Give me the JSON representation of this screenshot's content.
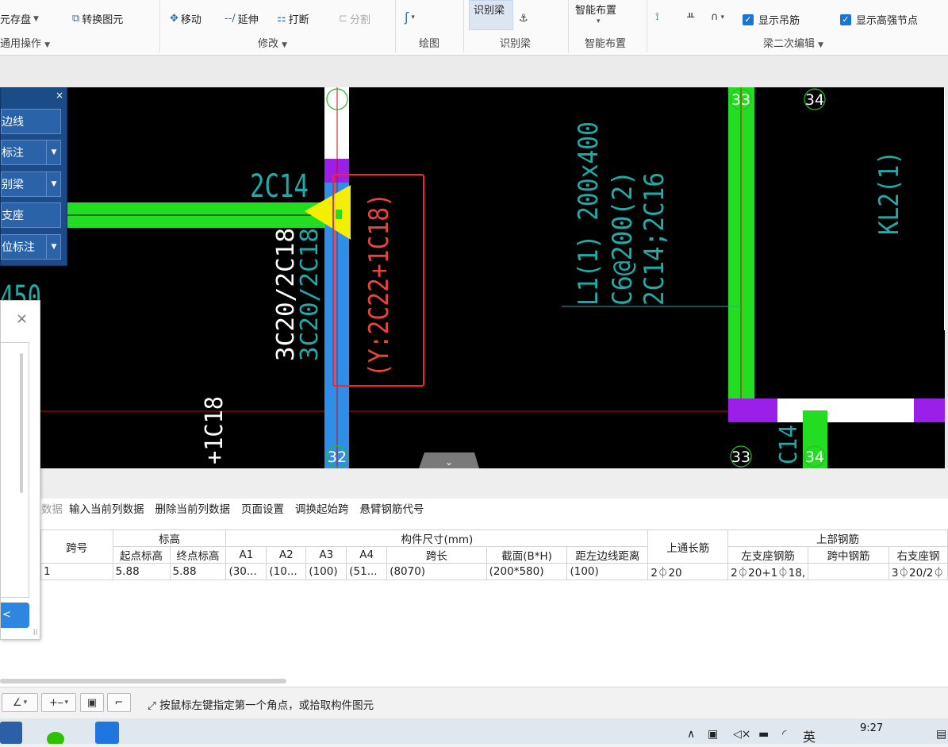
{
  "ribbon": {
    "group_common": "通用操作",
    "save_layout": "元存盘",
    "convert_entity": "转换图元",
    "move": "移动",
    "extend": "延伸",
    "break": "打断",
    "split": "分割",
    "group_modify": "修改",
    "group_draw": "绘图",
    "identify_beam_btn": "识别梁",
    "group_identify": "识别梁",
    "smart_layout_btn": "智能布置",
    "group_smart": "智能布置",
    "show_hanger": "显示吊筋",
    "show_hs_node": "显示高强节点",
    "group_beam_edit": "梁二次编辑"
  },
  "float_panel": {
    "items": [
      "边线",
      "标注",
      "别梁",
      "支座",
      "位标注"
    ],
    "close": "×"
  },
  "dialog": {
    "close": "×",
    "confirm_btn": "<"
  },
  "canvas": {
    "texts": {
      "t_2c14": "2C14",
      "t_3c20_white": "3C20/2C18",
      "t_3c20_cyan": "3C20/2C18",
      "t_y_red": "(Y:2C22+1C18)",
      "t_l1": "L1(1) 200x400",
      "t_c6": "C6@200(2)",
      "t_2c14b": "2C14;2C16",
      "t_kl2": "KL2(1)",
      "t_450": "450",
      "t_1c18": "+1C18",
      "t_c14": "C14",
      "n32": "32",
      "n33a": "33",
      "n34a": "34",
      "n33b": "33",
      "n34b": "34",
      "collapse": "⌄"
    }
  },
  "table_toolbar": [
    "数据",
    "输入当前列数据",
    "删除当前列数据",
    "页面设置",
    "调换起始跨",
    "悬臂钢筋代号"
  ],
  "table": {
    "header_top": {
      "span_no": "跨号",
      "elevation": "标高",
      "size": "构件尺寸(mm)",
      "top_through": "上通长筋",
      "top_rebar": "上部钢筋"
    },
    "header_sub": [
      "起点标高",
      "终点标高",
      "A1",
      "A2",
      "A3",
      "A4",
      "跨长",
      "截面(B*H)",
      "距左边线距离",
      "左支座钢筋",
      "跨中钢筋",
      "右支座钢"
    ],
    "row": [
      "1",
      "5.88",
      "5.88",
      "(30...",
      "(10...",
      "(100)",
      "(51...",
      "(8070)",
      "(200*580)",
      "(100)",
      "2⏀20",
      "2⏀20+1⏀18,",
      "",
      "3⏀20/2⏀"
    ]
  },
  "status": {
    "message": "按鼠标左键指定第一个角点，或拾取构件图元"
  },
  "taskbar": {
    "time": "9:27",
    "ime": "英"
  }
}
